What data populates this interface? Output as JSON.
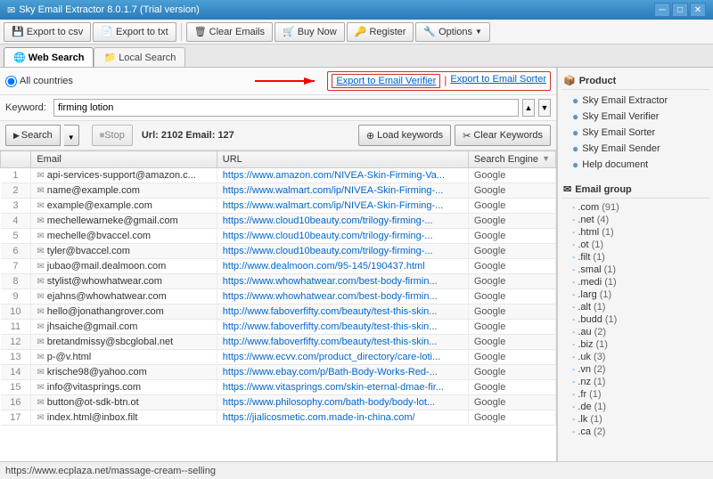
{
  "titlebar": {
    "title": "Sky Email Extractor 8.0.1.7 (Trial version)",
    "icon": "✉",
    "controls": {
      "minimize": "─",
      "maximize": "□",
      "close": "✕"
    }
  },
  "toolbar": {
    "export_csv": "Export to csv",
    "export_txt": "Export to txt",
    "clear_emails": "Clear Emails",
    "buy_now": "Buy Now",
    "register": "Register",
    "options": "Options"
  },
  "tabs": {
    "web_search": "Web Search",
    "local_search": "Local Search"
  },
  "search_config": {
    "country": "All countries",
    "export_verifier": "Export to Email Verifier",
    "export_sorter": "Export to Email Sorter"
  },
  "keyword": {
    "label": "Keyword:",
    "value": "firming lotion"
  },
  "controls": {
    "search": "Search",
    "stop": "Stop",
    "url_email": "Url: 2102 Email: 127",
    "load_keywords": "Load keywords",
    "clear_keywords": "Clear Keywords"
  },
  "table": {
    "headers": [
      "",
      "Email",
      "URL",
      "Search Engine"
    ],
    "rows": [
      {
        "num": "1",
        "email": "api-services-support@amazon.c...",
        "url": "https://www.amazon.com/NIVEA-Skin-Firming-Va...",
        "engine": "Google"
      },
      {
        "num": "2",
        "email": "name@example.com",
        "url": "https://www.walmart.com/ip/NIVEA-Skin-Firming-...",
        "engine": "Google"
      },
      {
        "num": "3",
        "email": "example@example.com",
        "url": "https://www.walmart.com/ip/NIVEA-Skin-Firming-...",
        "engine": "Google"
      },
      {
        "num": "4",
        "email": "mechellewarneke@gmail.com",
        "url": "https://www.cloud10beauty.com/trilogy-firming-...",
        "engine": "Google"
      },
      {
        "num": "5",
        "email": "mechelle@bvaccel.com",
        "url": "https://www.cloud10beauty.com/trilogy-firming-...",
        "engine": "Google"
      },
      {
        "num": "6",
        "email": "tyler@bvaccel.com",
        "url": "https://www.cloud10beauty.com/trilogy-firming-...",
        "engine": "Google"
      },
      {
        "num": "7",
        "email": "jubao@mail.dealmoon.com",
        "url": "http://www.dealmoon.com/95-145/190437.html",
        "engine": "Google"
      },
      {
        "num": "8",
        "email": "stylist@whowhatwear.com",
        "url": "https://www.whowhatwear.com/best-body-firmin...",
        "engine": "Google"
      },
      {
        "num": "9",
        "email": "ejahns@whowhatwear.com",
        "url": "https://www.whowhatwear.com/best-body-firmin...",
        "engine": "Google"
      },
      {
        "num": "10",
        "email": "hello@jonathangrover.com",
        "url": "http://www.faboverfifty.com/beauty/test-this-skin...",
        "engine": "Google"
      },
      {
        "num": "11",
        "email": "jhsaiche@gmail.com",
        "url": "http://www.faboverfifty.com/beauty/test-this-skin...",
        "engine": "Google"
      },
      {
        "num": "12",
        "email": "bretandmissy@sbcglobal.net",
        "url": "http://www.faboverfifty.com/beauty/test-this-skin...",
        "engine": "Google"
      },
      {
        "num": "13",
        "email": "p-@v.html",
        "url": "https://www.ecvv.com/product_directory/care-loti...",
        "engine": "Google"
      },
      {
        "num": "14",
        "email": "krische98@yahoo.com",
        "url": "https://www.ebay.com/p/Bath-Body-Works-Red-...",
        "engine": "Google"
      },
      {
        "num": "15",
        "email": "info@vitasprings.com",
        "url": "https://www.vitasprings.com/skin-eternal-dmae-fir...",
        "engine": "Google"
      },
      {
        "num": "16",
        "email": "button@ot-sdk-btn.ot",
        "url": "https://www.philosophy.com/bath-body/body-lot...",
        "engine": "Google"
      },
      {
        "num": "17",
        "email": "index.html@inbox.filt",
        "url": "https://jialicosmetic.com.made-in-china.com/",
        "engine": "Google"
      }
    ]
  },
  "right_panel": {
    "product_section": "Product",
    "product_icon": "📦",
    "product_items": [
      "Sky Email Extractor",
      "Sky Email Verifier",
      "Sky Email Sorter",
      "Sky Email Sender",
      "Help document"
    ],
    "email_group_section": "Email group",
    "email_group_icon": "✉",
    "email_groups": [
      {
        ".com": "(91)"
      },
      {
        ".net": "(4)"
      },
      {
        ".html": "(1)"
      },
      {
        ".ot": "(1)"
      },
      {
        ".filt": "(1)"
      },
      {
        ".smal": "(1)"
      },
      {
        ".medi": "(1)"
      },
      {
        ".larg": "(1)"
      },
      {
        ".alt": "(1)"
      },
      {
        ".budd": "(1)"
      },
      {
        ".au": "(2)"
      },
      {
        ".biz": "(1)"
      },
      {
        ".uk": "(3)"
      },
      {
        ".vn": "(2)"
      },
      {
        ".nz": "(1)"
      },
      {
        ".fr": "(1)"
      },
      {
        ".de": "(1)"
      },
      {
        ".lk": "(1)"
      },
      {
        ".ca": "(2)"
      }
    ],
    "email_groups_flat": [
      [
        ".com",
        "(91)"
      ],
      [
        ".net",
        "(4)"
      ],
      [
        ".html",
        "(1)"
      ],
      [
        ".ot",
        "(1)"
      ],
      [
        ".filt",
        "(1)"
      ],
      [
        ".smal",
        "(1)"
      ],
      [
        ".medi",
        "(1)"
      ],
      [
        ".larg",
        "(1)"
      ],
      [
        ".alt",
        "(1)"
      ],
      [
        ".budd",
        "(1)"
      ],
      [
        ".au",
        "(2)"
      ],
      [
        ".biz",
        "(1)"
      ],
      [
        ".uk",
        "(3)"
      ],
      [
        ".vn",
        "(2)"
      ],
      [
        ".nz",
        "(1)"
      ],
      [
        ".fr",
        "(1)"
      ],
      [
        ".de",
        "(1)"
      ],
      [
        ".lk",
        "(1)"
      ],
      [
        ".ca",
        "(2)"
      ]
    ]
  },
  "status_bar": {
    "text": "https://www.ecplaza.net/massage-cream--selling"
  }
}
